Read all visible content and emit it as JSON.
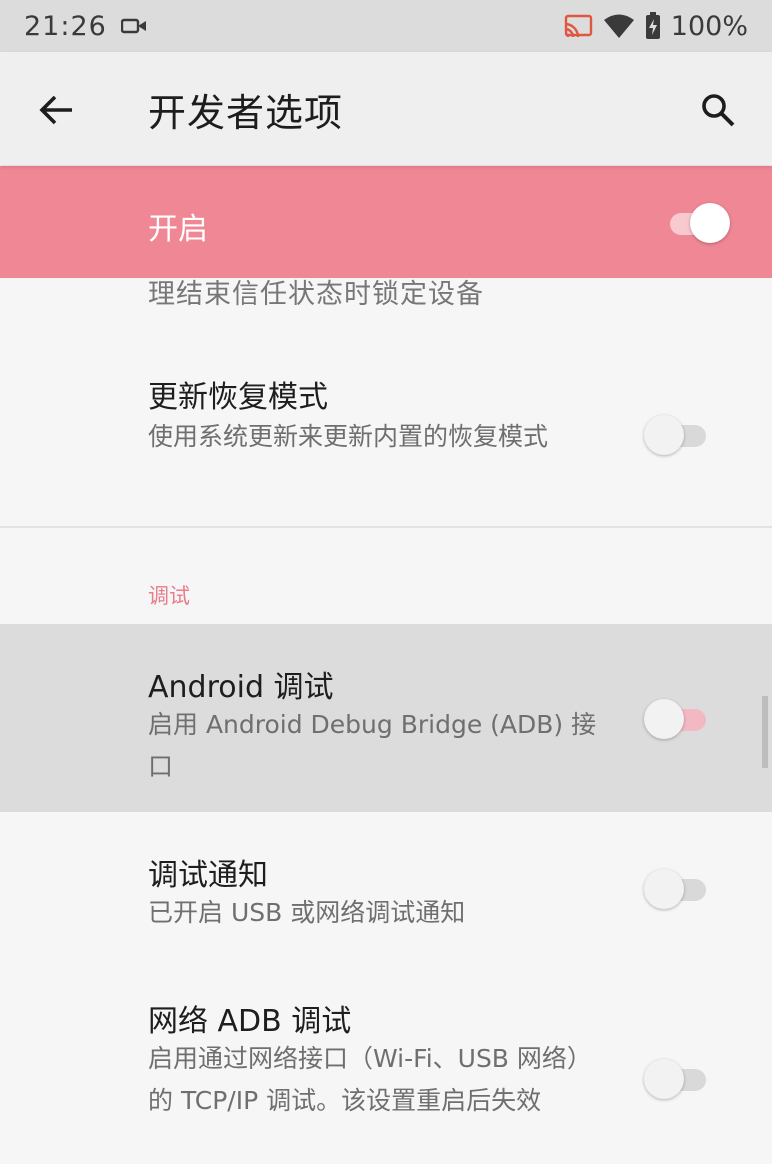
{
  "status_bar": {
    "time": "21:26",
    "battery": "100%"
  },
  "app_bar": {
    "title": "开发者选项"
  },
  "master_switch": {
    "label": "开启",
    "state": "on"
  },
  "partial_item_text": "理结束信任状态时锁定设备",
  "items": [
    {
      "title": "更新恢复模式",
      "summary": "使用系统更新来更新内置的恢复模式",
      "state": "off"
    },
    {
      "title": "Android 调试",
      "summary": "启用 Android Debug Bridge (ADB) 接口",
      "state": "off"
    },
    {
      "title": "调试通知",
      "summary": "已开启 USB 或网络调试通知",
      "state": "off"
    },
    {
      "title": "网络 ADB 调试",
      "summary": "启用通过网络接口（Wi-Fi、USB 网络）的 TCP/IP 调试。该设置重启后失效",
      "state": "off"
    }
  ],
  "section_debug": {
    "header": "调试"
  },
  "colors": {
    "accent": "#f08795",
    "section_header": "#e87d8b",
    "highlight_row": "#dcdcdc"
  }
}
